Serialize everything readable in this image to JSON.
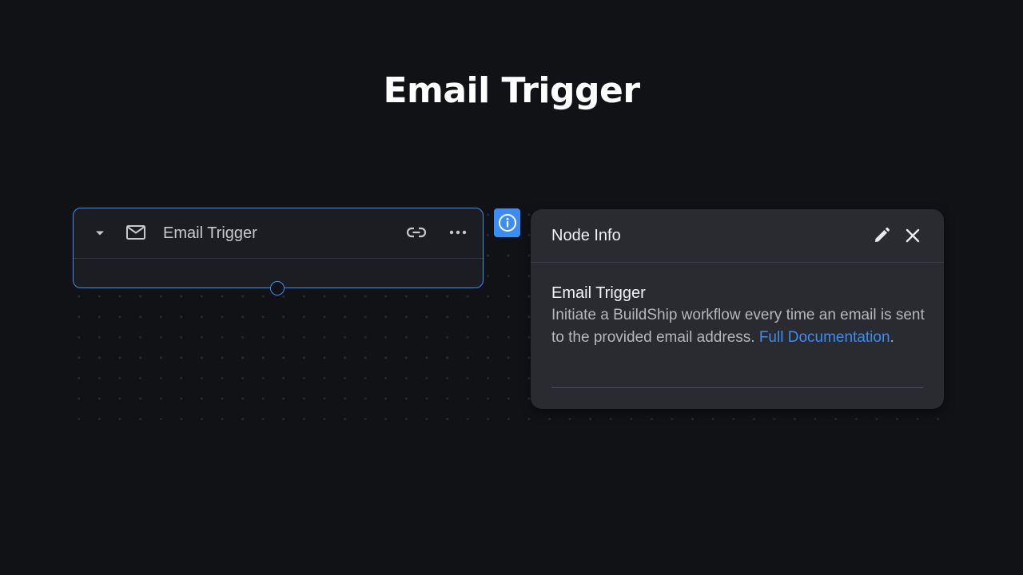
{
  "page": {
    "title": "Email Trigger"
  },
  "node": {
    "label": "Email Trigger",
    "icons": {
      "collapse": "caret-down-icon",
      "type": "mail-icon",
      "link": "link-icon",
      "more": "more-horizontal-icon"
    }
  },
  "info_badge": {
    "icon": "info-icon"
  },
  "info_panel": {
    "title": "Node Info",
    "heading": "Email Trigger",
    "description": "Initiate a BuildShip workflow every time an email is sent to the provided email address.",
    "link_text": "Full Documentation",
    "trailing": ".",
    "icons": {
      "edit": "pencil-icon",
      "close": "close-icon"
    }
  },
  "colors": {
    "background": "#111216",
    "accent": "#3b8cf3",
    "card": "#1b1d22",
    "panel": "#2a2b30"
  }
}
